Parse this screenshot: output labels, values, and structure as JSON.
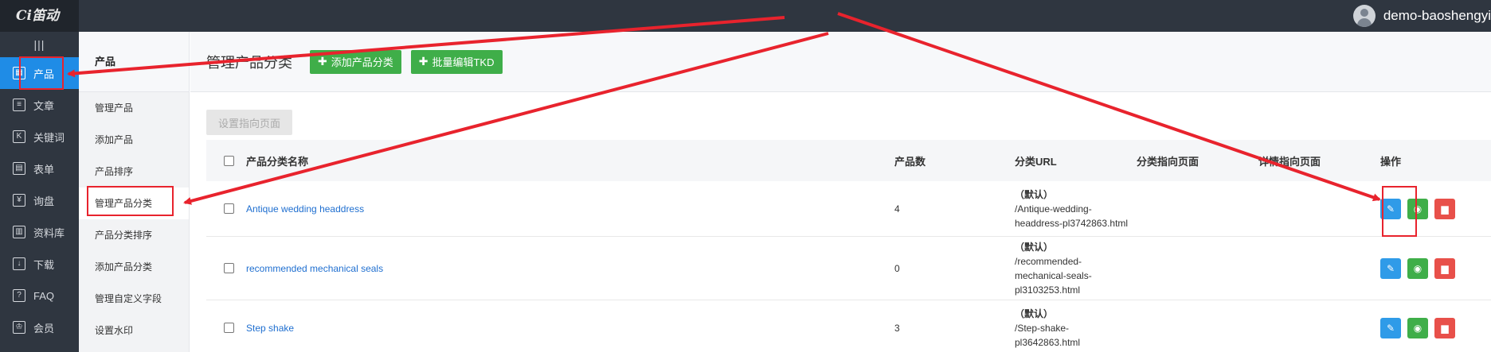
{
  "app": {
    "logo": "Ci笛动",
    "username": "demo-baoshengyi"
  },
  "leftnav": {
    "toggle": "|||",
    "items": [
      {
        "label": "产品",
        "icon": "grid-icon",
        "glyph": "▦",
        "active": true
      },
      {
        "label": "文章",
        "icon": "document-icon",
        "glyph": "≡",
        "active": false
      },
      {
        "label": "关键词",
        "icon": "keyword-icon",
        "glyph": "K",
        "active": false
      },
      {
        "label": "表单",
        "icon": "clipboard-icon",
        "glyph": "▤",
        "active": false
      },
      {
        "label": "询盘",
        "icon": "inquiry-icon",
        "glyph": "¥",
        "active": false
      },
      {
        "label": "资料库",
        "icon": "library-icon",
        "glyph": "▥",
        "active": false
      },
      {
        "label": "下载",
        "icon": "download-icon",
        "glyph": "↓",
        "active": false
      },
      {
        "label": "FAQ",
        "icon": "question-icon",
        "glyph": "?",
        "active": false
      },
      {
        "label": "会员",
        "icon": "crown-icon",
        "glyph": "♔",
        "active": false
      }
    ]
  },
  "submenu": {
    "title": "产品",
    "items": [
      {
        "label": "管理产品",
        "active": false
      },
      {
        "label": "添加产品",
        "active": false
      },
      {
        "label": "产品排序",
        "active": false
      },
      {
        "label": "管理产品分类",
        "active": true
      },
      {
        "label": "产品分类排序",
        "active": false
      },
      {
        "label": "添加产品分类",
        "active": false
      },
      {
        "label": "管理自定义字段",
        "active": false
      },
      {
        "label": "设置水印",
        "active": false
      }
    ]
  },
  "main": {
    "title": "管理产品分类",
    "add_button": "添加产品分类",
    "batch_button": "批量编辑TKD",
    "set_page_button": "设置指向页面"
  },
  "table": {
    "headers": {
      "name": "产品分类名称",
      "count": "产品数",
      "url": "分类URL",
      "page": "分类指向页面",
      "detail": "详情指向页面",
      "ops": "操作"
    },
    "rows": [
      {
        "name": "Antique wedding headdress",
        "count": "4",
        "default": "（默认）",
        "url_lines": [
          "/Antique-wedding-",
          "headdress-pl3742863.html"
        ]
      },
      {
        "name": "recommended mechanical seals",
        "count": "0",
        "default": "（默认）",
        "url_lines": [
          "/recommended-",
          "mechanical-seals-",
          "pl3103253.html"
        ]
      },
      {
        "name": "Step shake",
        "count": "3",
        "default": "（默认）",
        "url_lines": [
          "/Step-shake-",
          "pl3642863.html"
        ]
      }
    ]
  },
  "colors": {
    "topbar": "#2f3640",
    "active_nav": "#1f8ce6",
    "green_button": "#3fae49",
    "edit_button": "#2f9be8",
    "delete_button": "#e8504a",
    "annotation": "#e8232d"
  }
}
